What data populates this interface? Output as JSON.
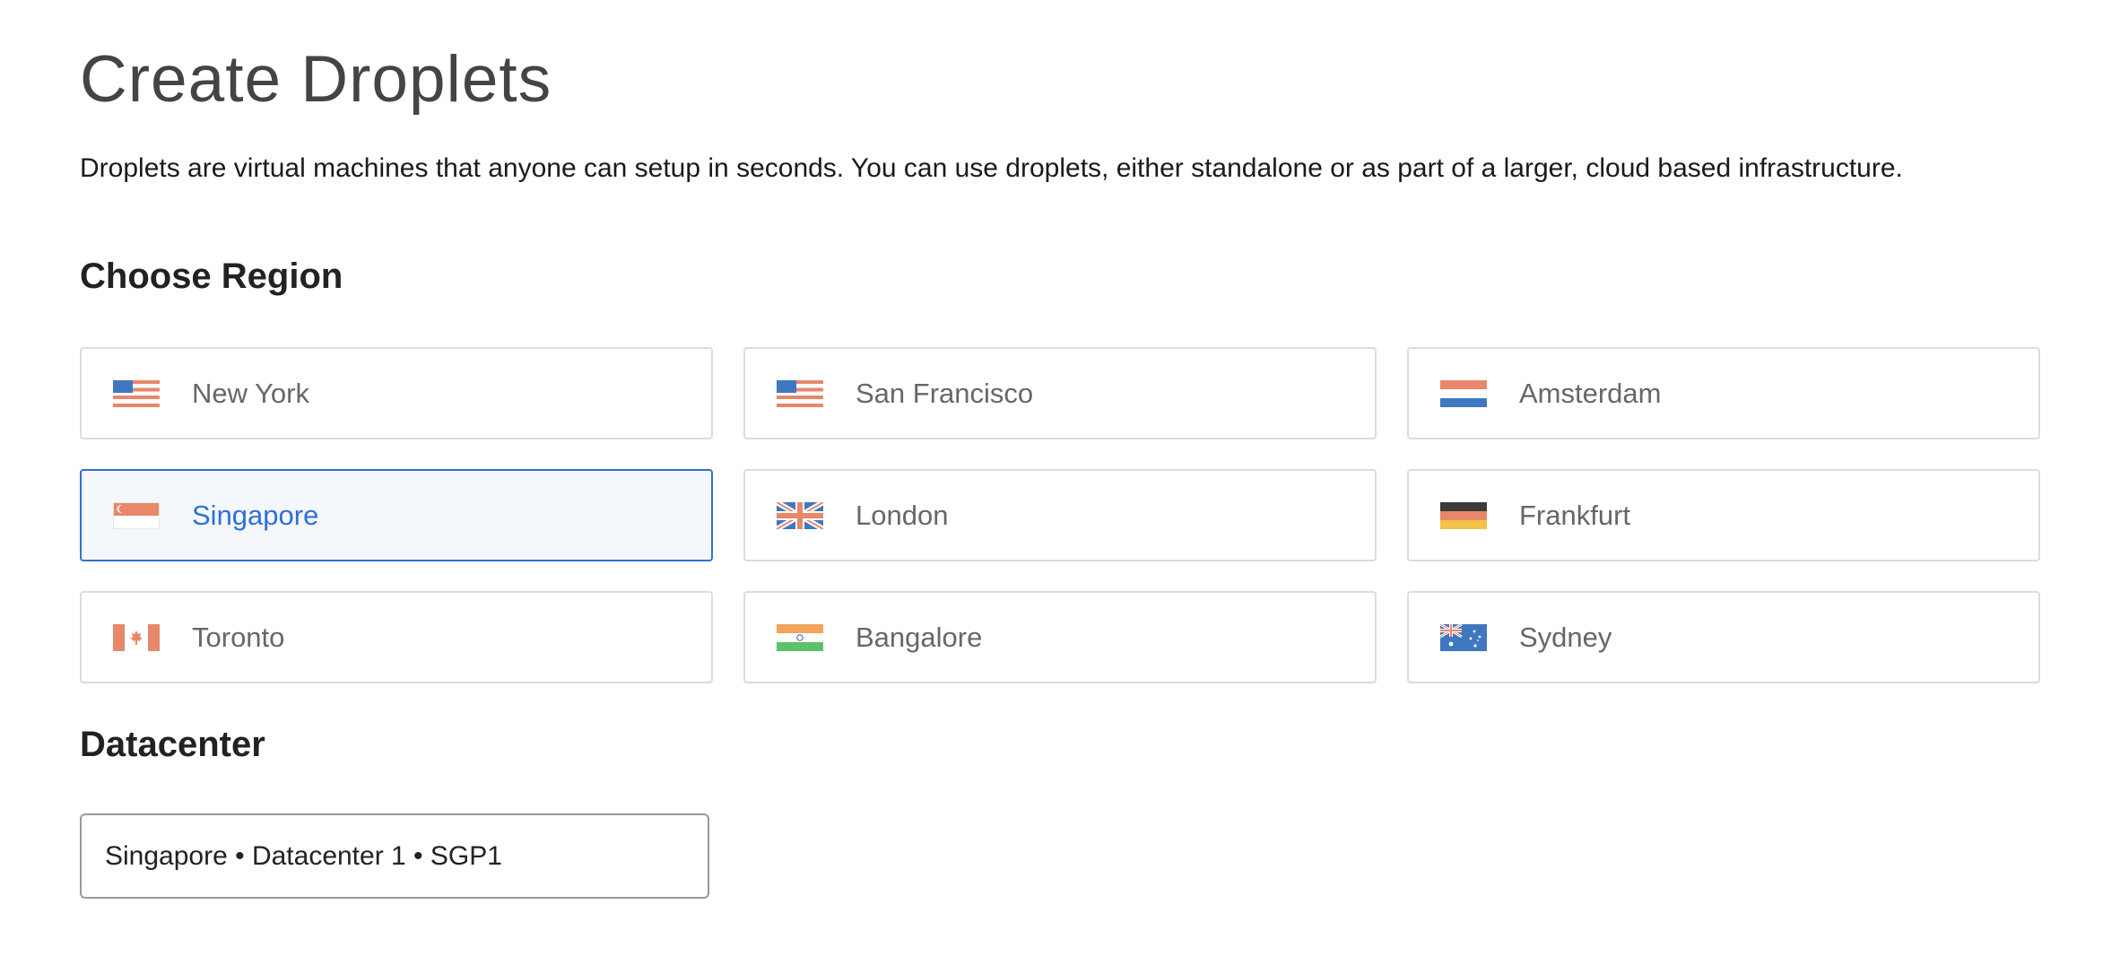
{
  "header": {
    "title": "Create Droplets",
    "description": "Droplets are virtual machines that anyone can setup in seconds. You can use droplets, either standalone or as part of a larger, cloud based infrastructure."
  },
  "region_section": {
    "heading": "Choose Region",
    "selected": "Singapore",
    "regions": [
      {
        "label": "New York",
        "flag_icon": "us-flag-icon"
      },
      {
        "label": "San Francisco",
        "flag_icon": "us-flag-icon"
      },
      {
        "label": "Amsterdam",
        "flag_icon": "netherlands-flag-icon"
      },
      {
        "label": "Singapore",
        "flag_icon": "singapore-flag-icon"
      },
      {
        "label": "London",
        "flag_icon": "uk-flag-icon"
      },
      {
        "label": "Frankfurt",
        "flag_icon": "germany-flag-icon"
      },
      {
        "label": "Toronto",
        "flag_icon": "canada-flag-icon"
      },
      {
        "label": "Bangalore",
        "flag_icon": "india-flag-icon"
      },
      {
        "label": "Sydney",
        "flag_icon": "australia-flag-icon"
      }
    ]
  },
  "datacenter_section": {
    "heading": "Datacenter",
    "selected_value": "Singapore • Datacenter 1 • SGP1"
  },
  "colors": {
    "accent": "#2f6fd6",
    "selected_background": "#f4f8fc",
    "card_border": "#dcdcdc",
    "muted_text": "#676767"
  }
}
